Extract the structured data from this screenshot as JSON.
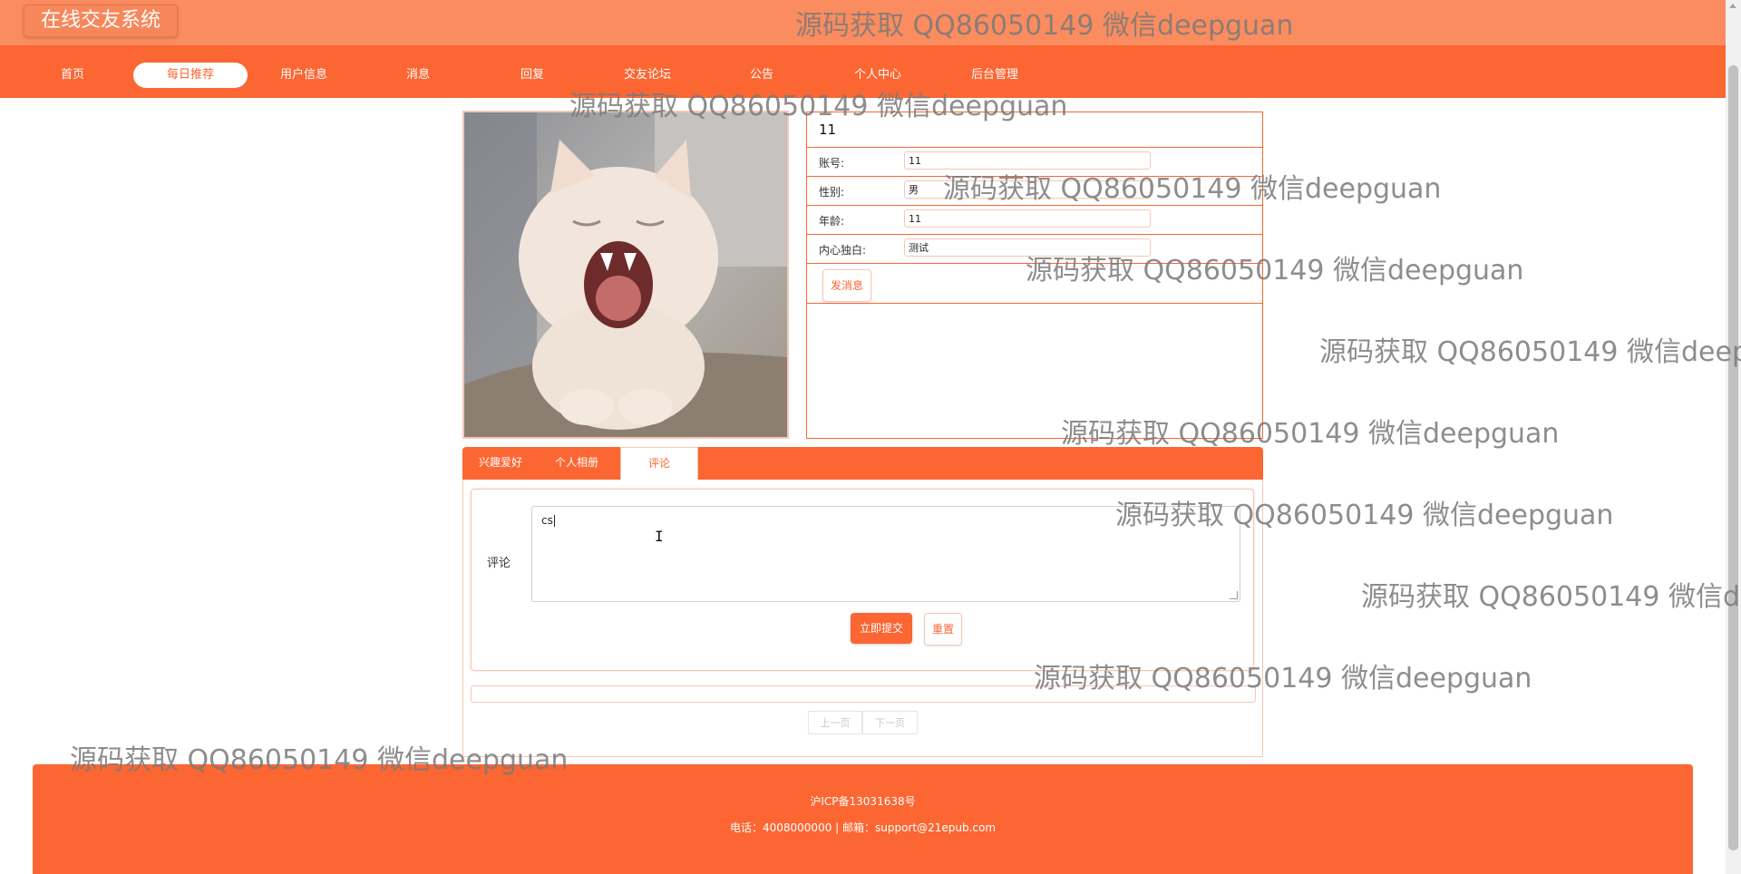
{
  "header": {
    "logo_text": "在线交友系统"
  },
  "nav": {
    "items": [
      {
        "label": "首页",
        "active": false
      },
      {
        "label": "每日推荐",
        "active": true
      },
      {
        "label": "用户信息",
        "active": false
      },
      {
        "label": "消息",
        "active": false
      },
      {
        "label": "回复",
        "active": false
      },
      {
        "label": "交友论坛",
        "active": false
      },
      {
        "label": "公告",
        "active": false
      },
      {
        "label": "个人中心",
        "active": false
      },
      {
        "label": "后台管理",
        "active": false
      }
    ]
  },
  "watermark": {
    "text": "源码获取 QQ86050149 微信deepguan",
    "text_cut_1": "源码获取 QQ86050149 微信deepc",
    "text_cut_2": "源码获取 QQ86050149 微信de"
  },
  "profile": {
    "photo_icon": "cat-photo",
    "title": "11",
    "fields": [
      {
        "label": "账号:",
        "value": "11"
      },
      {
        "label": "性别:",
        "value": "男"
      },
      {
        "label": "年龄:",
        "value": "11"
      },
      {
        "label": "内心独白:",
        "value": "测试"
      }
    ],
    "send_message_label": "发消息"
  },
  "tabs": {
    "items": [
      {
        "label": "兴趣爱好",
        "active": false
      },
      {
        "label": "个人相册",
        "active": false
      },
      {
        "label": "评论",
        "active": true
      }
    ]
  },
  "comment_form": {
    "label": "评论",
    "value": "cs",
    "submit_label": "立即提交",
    "reset_label": "重置"
  },
  "pagination": {
    "prev_label": "上一页",
    "next_label": "下一页"
  },
  "footer": {
    "icp": "沪ICP备13031638号",
    "contact": "电话：4008000000 | 邮箱：support@21epub.com"
  },
  "colors": {
    "primary": "#fb6633",
    "header": "#fb8c5f",
    "border_light": "#f6c7b5"
  }
}
